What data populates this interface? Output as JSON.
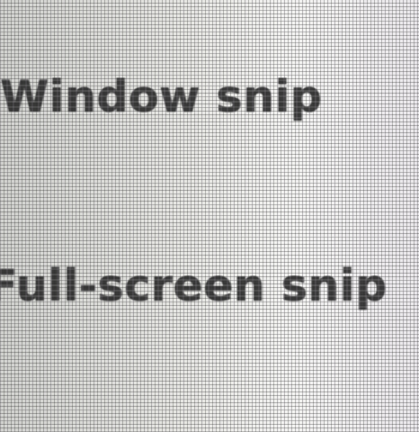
{
  "snip_menu": {
    "items": [
      {
        "label": "Window snip"
      },
      {
        "label": "Full-screen snip"
      }
    ]
  },
  "colors": {
    "background": "#e6e6e2",
    "text": "#2c2c2c"
  }
}
